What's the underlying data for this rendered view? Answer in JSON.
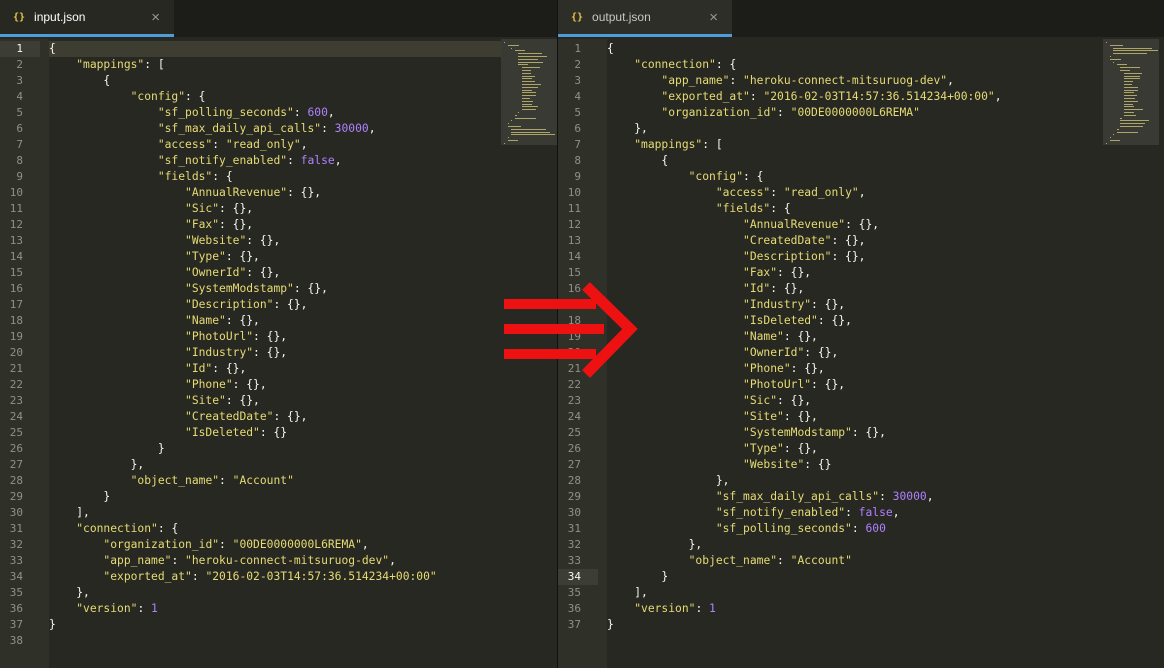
{
  "left": {
    "tab": {
      "icon": "{}",
      "title": "input.json",
      "close": "×"
    },
    "active_line": 1,
    "lines": [
      [
        [
          "p",
          "{"
        ]
      ],
      [
        [
          "p",
          "    "
        ],
        [
          "k",
          "\"mappings\""
        ],
        [
          "p",
          ": ["
        ]
      ],
      [
        [
          "p",
          "        {"
        ]
      ],
      [
        [
          "p",
          "            "
        ],
        [
          "k",
          "\"config\""
        ],
        [
          "p",
          ": {"
        ]
      ],
      [
        [
          "p",
          "                "
        ],
        [
          "k",
          "\"sf_polling_seconds\""
        ],
        [
          "p",
          ": "
        ],
        [
          "n",
          "600"
        ],
        [
          "p",
          ","
        ]
      ],
      [
        [
          "p",
          "                "
        ],
        [
          "k",
          "\"sf_max_daily_api_calls\""
        ],
        [
          "p",
          ": "
        ],
        [
          "n",
          "30000"
        ],
        [
          "p",
          ","
        ]
      ],
      [
        [
          "p",
          "                "
        ],
        [
          "k",
          "\"access\""
        ],
        [
          "p",
          ": "
        ],
        [
          "s",
          "\"read_only\""
        ],
        [
          "p",
          ","
        ]
      ],
      [
        [
          "p",
          "                "
        ],
        [
          "k",
          "\"sf_notify_enabled\""
        ],
        [
          "p",
          ": "
        ],
        [
          "b",
          "false"
        ],
        [
          "p",
          ","
        ]
      ],
      [
        [
          "p",
          "                "
        ],
        [
          "k",
          "\"fields\""
        ],
        [
          "p",
          ": {"
        ]
      ],
      [
        [
          "p",
          "                    "
        ],
        [
          "k",
          "\"AnnualRevenue\""
        ],
        [
          "p",
          ": {},"
        ]
      ],
      [
        [
          "p",
          "                    "
        ],
        [
          "k",
          "\"Sic\""
        ],
        [
          "p",
          ": {},"
        ]
      ],
      [
        [
          "p",
          "                    "
        ],
        [
          "k",
          "\"Fax\""
        ],
        [
          "p",
          ": {},"
        ]
      ],
      [
        [
          "p",
          "                    "
        ],
        [
          "k",
          "\"Website\""
        ],
        [
          "p",
          ": {},"
        ]
      ],
      [
        [
          "p",
          "                    "
        ],
        [
          "k",
          "\"Type\""
        ],
        [
          "p",
          ": {},"
        ]
      ],
      [
        [
          "p",
          "                    "
        ],
        [
          "k",
          "\"OwnerId\""
        ],
        [
          "p",
          ": {},"
        ]
      ],
      [
        [
          "p",
          "                    "
        ],
        [
          "k",
          "\"SystemModstamp\""
        ],
        [
          "p",
          ": {},"
        ]
      ],
      [
        [
          "p",
          "                    "
        ],
        [
          "k",
          "\"Description\""
        ],
        [
          "p",
          ": {},"
        ]
      ],
      [
        [
          "p",
          "                    "
        ],
        [
          "k",
          "\"Name\""
        ],
        [
          "p",
          ": {},"
        ]
      ],
      [
        [
          "p",
          "                    "
        ],
        [
          "k",
          "\"PhotoUrl\""
        ],
        [
          "p",
          ": {},"
        ]
      ],
      [
        [
          "p",
          "                    "
        ],
        [
          "k",
          "\"Industry\""
        ],
        [
          "p",
          ": {},"
        ]
      ],
      [
        [
          "p",
          "                    "
        ],
        [
          "k",
          "\"Id\""
        ],
        [
          "p",
          ": {},"
        ]
      ],
      [
        [
          "p",
          "                    "
        ],
        [
          "k",
          "\"Phone\""
        ],
        [
          "p",
          ": {},"
        ]
      ],
      [
        [
          "p",
          "                    "
        ],
        [
          "k",
          "\"Site\""
        ],
        [
          "p",
          ": {},"
        ]
      ],
      [
        [
          "p",
          "                    "
        ],
        [
          "k",
          "\"CreatedDate\""
        ],
        [
          "p",
          ": {},"
        ]
      ],
      [
        [
          "p",
          "                    "
        ],
        [
          "k",
          "\"IsDeleted\""
        ],
        [
          "p",
          ": {}"
        ]
      ],
      [
        [
          "p",
          "                }"
        ]
      ],
      [
        [
          "p",
          "            },"
        ]
      ],
      [
        [
          "p",
          "            "
        ],
        [
          "k",
          "\"object_name\""
        ],
        [
          "p",
          ": "
        ],
        [
          "s",
          "\"Account\""
        ]
      ],
      [
        [
          "p",
          "        }"
        ]
      ],
      [
        [
          "p",
          "    ],"
        ]
      ],
      [
        [
          "p",
          "    "
        ],
        [
          "k",
          "\"connection\""
        ],
        [
          "p",
          ": {"
        ]
      ],
      [
        [
          "p",
          "        "
        ],
        [
          "k",
          "\"organization_id\""
        ],
        [
          "p",
          ": "
        ],
        [
          "s",
          "\"00DE0000000L6REMA\""
        ],
        [
          "p",
          ","
        ]
      ],
      [
        [
          "p",
          "        "
        ],
        [
          "k",
          "\"app_name\""
        ],
        [
          "p",
          ": "
        ],
        [
          "s",
          "\"heroku-connect-mitsuruog-dev\""
        ],
        [
          "p",
          ","
        ]
      ],
      [
        [
          "p",
          "        "
        ],
        [
          "k",
          "\"exported_at\""
        ],
        [
          "p",
          ": "
        ],
        [
          "s",
          "\"2016-02-03T14:57:36.514234+00:00\""
        ]
      ],
      [
        [
          "p",
          "    },"
        ]
      ],
      [
        [
          "p",
          "    "
        ],
        [
          "k",
          "\"version\""
        ],
        [
          "p",
          ": "
        ],
        [
          "n",
          "1"
        ]
      ],
      [
        [
          "p",
          "}"
        ]
      ],
      []
    ]
  },
  "right": {
    "tab": {
      "icon": "{}",
      "title": "output.json",
      "close": "×"
    },
    "active_line": 34,
    "lines": [
      [
        [
          "p",
          "{"
        ]
      ],
      [
        [
          "p",
          "    "
        ],
        [
          "k",
          "\"connection\""
        ],
        [
          "p",
          ": {"
        ]
      ],
      [
        [
          "p",
          "        "
        ],
        [
          "k",
          "\"app_name\""
        ],
        [
          "p",
          ": "
        ],
        [
          "s",
          "\"heroku-connect-mitsuruog-dev\""
        ],
        [
          "p",
          ","
        ]
      ],
      [
        [
          "p",
          "        "
        ],
        [
          "k",
          "\"exported_at\""
        ],
        [
          "p",
          ": "
        ],
        [
          "s",
          "\"2016-02-03T14:57:36.514234+00:00\""
        ],
        [
          "p",
          ","
        ]
      ],
      [
        [
          "p",
          "        "
        ],
        [
          "k",
          "\"organization_id\""
        ],
        [
          "p",
          ": "
        ],
        [
          "s",
          "\"00DE0000000L6REMA\""
        ]
      ],
      [
        [
          "p",
          "    },"
        ]
      ],
      [
        [
          "p",
          "    "
        ],
        [
          "k",
          "\"mappings\""
        ],
        [
          "p",
          ": ["
        ]
      ],
      [
        [
          "p",
          "        {"
        ]
      ],
      [
        [
          "p",
          "            "
        ],
        [
          "k",
          "\"config\""
        ],
        [
          "p",
          ": {"
        ]
      ],
      [
        [
          "p",
          "                "
        ],
        [
          "k",
          "\"access\""
        ],
        [
          "p",
          ": "
        ],
        [
          "s",
          "\"read_only\""
        ],
        [
          "p",
          ","
        ]
      ],
      [
        [
          "p",
          "                "
        ],
        [
          "k",
          "\"fields\""
        ],
        [
          "p",
          ": {"
        ]
      ],
      [
        [
          "p",
          "                    "
        ],
        [
          "k",
          "\"AnnualRevenue\""
        ],
        [
          "p",
          ": {},"
        ]
      ],
      [
        [
          "p",
          "                    "
        ],
        [
          "k",
          "\"CreatedDate\""
        ],
        [
          "p",
          ": {},"
        ]
      ],
      [
        [
          "p",
          "                    "
        ],
        [
          "k",
          "\"Description\""
        ],
        [
          "p",
          ": {},"
        ]
      ],
      [
        [
          "p",
          "                    "
        ],
        [
          "k",
          "\"Fax\""
        ],
        [
          "p",
          ": {},"
        ]
      ],
      [
        [
          "p",
          "                    "
        ],
        [
          "k",
          "\"Id\""
        ],
        [
          "p",
          ": {},"
        ]
      ],
      [
        [
          "p",
          "                    "
        ],
        [
          "k",
          "\"Industry\""
        ],
        [
          "p",
          ": {},"
        ]
      ],
      [
        [
          "p",
          "                    "
        ],
        [
          "k",
          "\"IsDeleted\""
        ],
        [
          "p",
          ": {},"
        ]
      ],
      [
        [
          "p",
          "                    "
        ],
        [
          "k",
          "\"Name\""
        ],
        [
          "p",
          ": {},"
        ]
      ],
      [
        [
          "p",
          "                    "
        ],
        [
          "k",
          "\"OwnerId\""
        ],
        [
          "p",
          ": {},"
        ]
      ],
      [
        [
          "p",
          "                    "
        ],
        [
          "k",
          "\"Phone\""
        ],
        [
          "p",
          ": {},"
        ]
      ],
      [
        [
          "p",
          "                    "
        ],
        [
          "k",
          "\"PhotoUrl\""
        ],
        [
          "p",
          ": {},"
        ]
      ],
      [
        [
          "p",
          "                    "
        ],
        [
          "k",
          "\"Sic\""
        ],
        [
          "p",
          ": {},"
        ]
      ],
      [
        [
          "p",
          "                    "
        ],
        [
          "k",
          "\"Site\""
        ],
        [
          "p",
          ": {},"
        ]
      ],
      [
        [
          "p",
          "                    "
        ],
        [
          "k",
          "\"SystemModstamp\""
        ],
        [
          "p",
          ": {},"
        ]
      ],
      [
        [
          "p",
          "                    "
        ],
        [
          "k",
          "\"Type\""
        ],
        [
          "p",
          ": {},"
        ]
      ],
      [
        [
          "p",
          "                    "
        ],
        [
          "k",
          "\"Website\""
        ],
        [
          "p",
          ": {}"
        ]
      ],
      [
        [
          "p",
          "                },"
        ]
      ],
      [
        [
          "p",
          "                "
        ],
        [
          "k",
          "\"sf_max_daily_api_calls\""
        ],
        [
          "p",
          ": "
        ],
        [
          "n",
          "30000"
        ],
        [
          "p",
          ","
        ]
      ],
      [
        [
          "p",
          "                "
        ],
        [
          "k",
          "\"sf_notify_enabled\""
        ],
        [
          "p",
          ": "
        ],
        [
          "b",
          "false"
        ],
        [
          "p",
          ","
        ]
      ],
      [
        [
          "p",
          "                "
        ],
        [
          "k",
          "\"sf_polling_seconds\""
        ],
        [
          "p",
          ": "
        ],
        [
          "n",
          "600"
        ]
      ],
      [
        [
          "p",
          "            },"
        ]
      ],
      [
        [
          "p",
          "            "
        ],
        [
          "k",
          "\"object_name\""
        ],
        [
          "p",
          ": "
        ],
        [
          "s",
          "\"Account\""
        ]
      ],
      [
        [
          "p",
          "        }"
        ]
      ],
      [
        [
          "p",
          "    ],"
        ]
      ],
      [
        [
          "p",
          "    "
        ],
        [
          "k",
          "\"version\""
        ],
        [
          "p",
          ": "
        ],
        [
          "n",
          "1"
        ]
      ],
      [
        [
          "p",
          "}"
        ]
      ]
    ]
  },
  "colors": {
    "arrow": "#ee1111",
    "key": "#e6db74",
    "string": "#e6db74",
    "number": "#ae81ff",
    "tab_accent": "#4d9ed8"
  },
  "overlay": {
    "icon": "right-arrow-icon"
  }
}
